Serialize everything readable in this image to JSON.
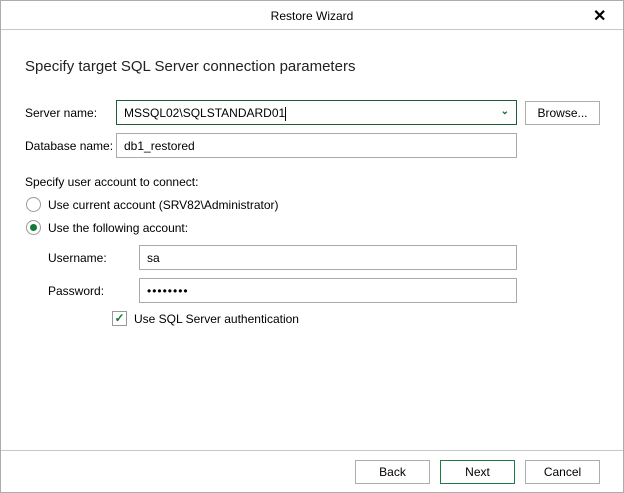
{
  "window": {
    "title": "Restore Wizard"
  },
  "heading": "Specify target SQL Server connection parameters",
  "server": {
    "label": "Server name:",
    "value": "MSSQL02\\SQLSTANDARD01",
    "browse_label": "Browse..."
  },
  "database": {
    "label": "Database name:",
    "value": "db1_restored"
  },
  "account": {
    "label": "Specify user account to connect:",
    "option_current": "Use current account (SRV82\\Administrator)",
    "option_following": "Use the following account:",
    "selected": "following"
  },
  "username": {
    "label": "Username:",
    "value": "sa"
  },
  "password": {
    "label": "Password:",
    "value": "••••••••"
  },
  "sql_auth": {
    "label": "Use SQL Server authentication",
    "checked": true
  },
  "footer": {
    "back": "Back",
    "next": "Next",
    "cancel": "Cancel"
  }
}
